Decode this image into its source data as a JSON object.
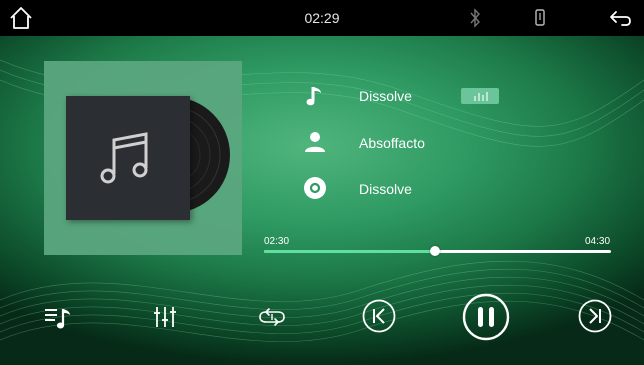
{
  "status_bar": {
    "time": "02:29",
    "icons": [
      "home-icon",
      "bluetooth-icon",
      "phone-link-icon",
      "back-icon"
    ]
  },
  "now_playing": {
    "title": "Dissolve",
    "artist": "Absoffacto",
    "album": "Dissolve",
    "icons": [
      "music-note-icon",
      "person-icon",
      "disc-icon",
      "equalizer-badge-icon"
    ]
  },
  "progress": {
    "current_time": "02:30",
    "total_time": "04:30",
    "fraction": 0.493
  },
  "controls": {
    "icons": [
      "playlist-icon",
      "equalizer-settings-icon",
      "repeat-icon",
      "previous-icon",
      "pause-icon",
      "next-icon"
    ]
  },
  "colors": {
    "accent": "#5fe0a0",
    "background_center": "#4fb57d",
    "background_edge": "#062a17",
    "status_bar": "#000000"
  }
}
